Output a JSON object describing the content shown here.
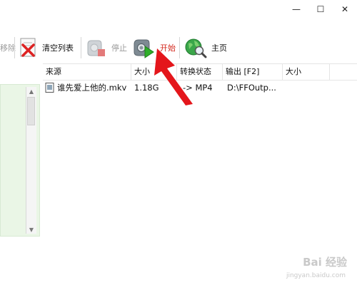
{
  "window_controls": {
    "minimize": "—",
    "maximize": "☐",
    "close": "✕"
  },
  "toolbar": {
    "remove_label": "移除",
    "clear_list_label": "清空列表",
    "stop_label": "停止",
    "start_label": "开始",
    "home_label": "主页",
    "start_color": "#d42a1f"
  },
  "table": {
    "headers": [
      "来源",
      "大小",
      "转换状态",
      "输出 [F2]",
      "大小"
    ],
    "rows": [
      {
        "source": "谁先爱上他的.mkv",
        "size": "1.18G",
        "status": "-> MP4",
        "output": "D:\\FFOutp...",
        "out_size": ""
      }
    ]
  },
  "watermark": {
    "text": "Bai 经验",
    "sub": "jingyan.baidu.com"
  }
}
